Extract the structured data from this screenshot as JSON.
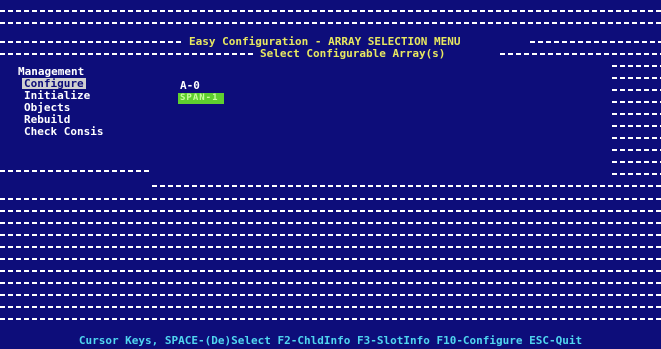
{
  "header": {
    "menu_title": "Easy Configuration - ARRAY SELECTION MENU",
    "submenu_title": "Select Configurable Array(s)"
  },
  "management": {
    "title": "Management",
    "items": [
      {
        "label": "Configure",
        "selected": true
      },
      {
        "label": "Initialize",
        "selected": false
      },
      {
        "label": "Objects",
        "selected": false
      },
      {
        "label": "Rebuild",
        "selected": false
      },
      {
        "label": "Check Consis",
        "selected": false
      }
    ]
  },
  "arrays": {
    "items": [
      {
        "label": "A-0"
      }
    ],
    "selected_chip_text": "SPAN-1"
  },
  "footer": {
    "help_text": "Cursor Keys, SPACE-(De)Select F2-ChldInfo F3-SlotInfo F10-Configure ESC-Quit"
  },
  "colors": {
    "background": "#0d0d7a",
    "title_text": "#e8e860",
    "footer_text": "#4fd6f0",
    "selected_chip": "#5fcf2f",
    "menu_highlight": "#d0d0d0"
  }
}
